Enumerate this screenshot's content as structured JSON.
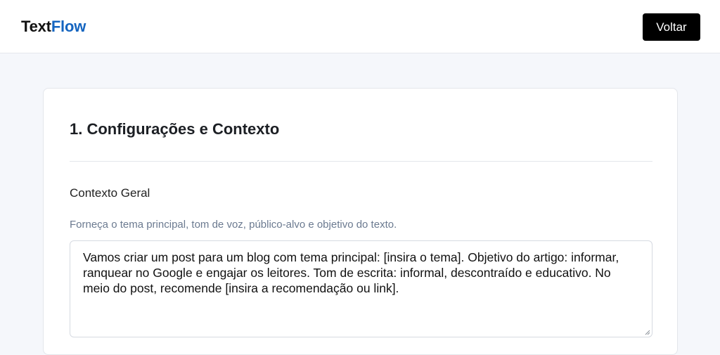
{
  "header": {
    "logo_part1": "Text",
    "logo_part2": "Flow",
    "back_label": "Voltar"
  },
  "section": {
    "title": "1. Configurações e Contexto",
    "field_label": "Contexto Geral",
    "field_hint": "Forneça o tema principal, tom de voz, público-alvo e objetivo do texto.",
    "textarea_value": "Vamos criar um post para um blog com tema principal: [insira o tema]. Objetivo do artigo: informar, ranquear no Google e engajar os leitores. Tom de escrita: informal, descontraído e educativo. No meio do post, recomende [insira a recomendação ou link]."
  },
  "colors": {
    "brand_accent": "#1565c0",
    "button_bg": "#000000",
    "page_bg": "#f5f7fb"
  }
}
